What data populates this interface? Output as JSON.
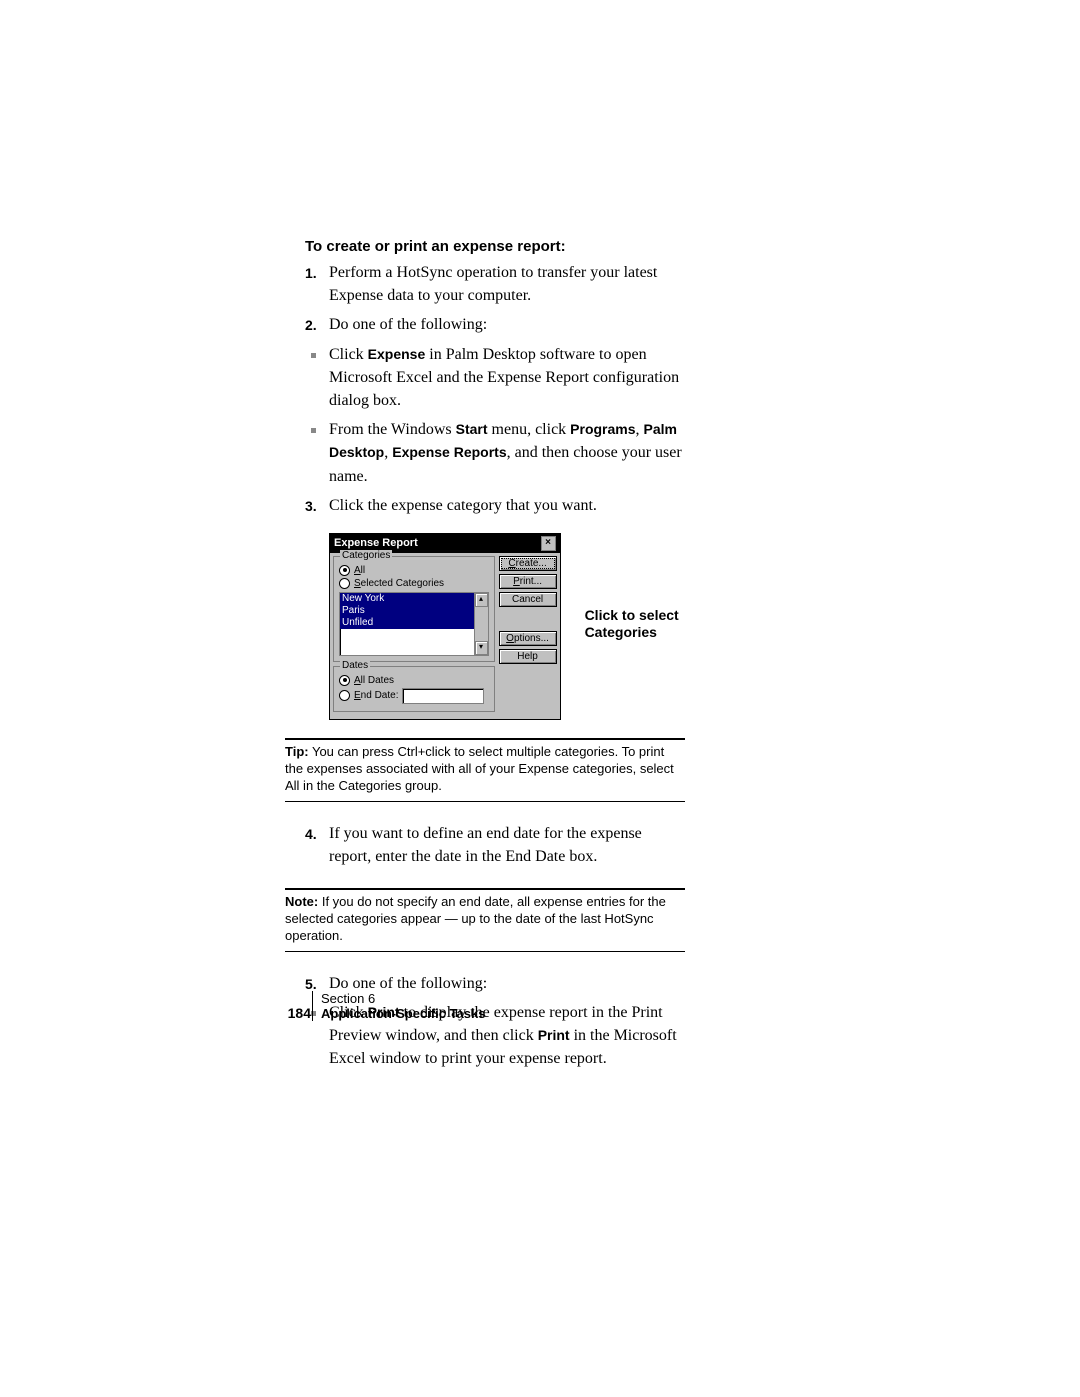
{
  "heading": "To create or print an expense report:",
  "steps": {
    "s1": "Perform a HotSync operation to transfer your latest Expense data to your computer.",
    "s2": "Do one of the following:",
    "s2a_pre": "Click ",
    "s2a_b1": "Expense",
    "s2a_post": " in Palm Desktop software to open Microsoft Excel and the Expense Report configuration dialog box.",
    "s2b_1": "From the Windows ",
    "s2b_b1": "Start",
    "s2b_2": " menu, click ",
    "s2b_b2": "Programs",
    "s2b_3": ", ",
    "s2b_b3": "Palm Desktop",
    "s2b_4": ", ",
    "s2b_b4": "Expense Reports",
    "s2b_5": ", and then choose your user name.",
    "s3": "Click the expense category that you want.",
    "s4": "If you want to define an end date for the expense report, enter the date in the End Date box.",
    "s5": "Do one of the following:",
    "s5a_pre": "Click ",
    "s5a_b1": "Print",
    "s5a_mid": " to display the expense report in the Print Preview window, and then click ",
    "s5a_b2": "Print",
    "s5a_post": " in the Microsoft Excel window to print your expense report."
  },
  "nums": {
    "n1": "1.",
    "n2": "2.",
    "n3": "3.",
    "n4": "4.",
    "n5": "5."
  },
  "callout": "Click to select Categories",
  "tip": {
    "label": "Tip:",
    "text": " You can press Ctrl+click to select multiple categories. To print the expenses associated with all of your Expense categories, select All in the Categories group."
  },
  "note": {
    "label": "Note:",
    "text": " If you do not specify an end date, all expense entries for the selected categories appear — up to the date of the last HotSync operation."
  },
  "dialog": {
    "title": "Expense Report",
    "close": "×",
    "group_categories": "Categories",
    "radio_all_pre": "A",
    "radio_all_post": "ll",
    "radio_sel_pre": "S",
    "radio_sel_post": "elected Categories",
    "list_items": [
      "New York",
      "Paris",
      "Unfiled"
    ],
    "group_dates": "Dates",
    "radio_alldates_pre": "A",
    "radio_alldates_post": "ll Dates",
    "radio_enddate_pre": "E",
    "radio_enddate_post": "nd Date:",
    "buttons": {
      "create_pre": "C",
      "create_post": "reate...",
      "print_pre": "P",
      "print_post": "rint...",
      "cancel": "Cancel",
      "options_pre": "O",
      "options_post": "ptions...",
      "help": "Help"
    },
    "scroll_up": "▴",
    "scroll_down": "▾"
  },
  "footer": {
    "section_pre": "Section ",
    "section_num": "6",
    "pagenum": "184",
    "chapter": "Application-Specific Tasks"
  }
}
